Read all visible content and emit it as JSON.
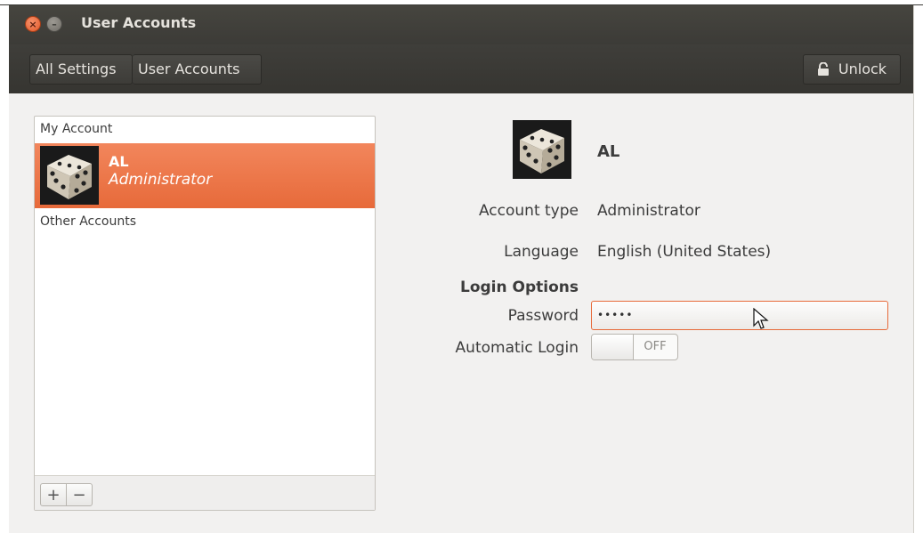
{
  "window": {
    "title": "User Accounts",
    "close_icon": "close-icon",
    "minimize_icon": "minimize-icon"
  },
  "toolbar": {
    "breadcrumb": [
      "All Settings",
      "User Accounts"
    ],
    "unlock_label": "Unlock",
    "unlock_icon": "lock-icon"
  },
  "accounts": {
    "my_account_header": "My Account",
    "selected": {
      "name": "AL",
      "role": "Administrator",
      "avatar_icon": "dice-avatar-icon"
    },
    "other_accounts_header": "Other Accounts",
    "add_label": "+",
    "remove_label": "−"
  },
  "details": {
    "name": "AL",
    "account_type_label": "Account type",
    "account_type_value": "Administrator",
    "language_label": "Language",
    "language_value": "English (United States)",
    "login_options_label": "Login Options",
    "password_label": "Password",
    "password_value": "•••••",
    "automatic_login_label": "Automatic Login",
    "automatic_login_state": "OFF"
  },
  "colors": {
    "accent": "#e76a3a",
    "titlebar": "#3c3b37",
    "background": "#f2f1f0"
  }
}
